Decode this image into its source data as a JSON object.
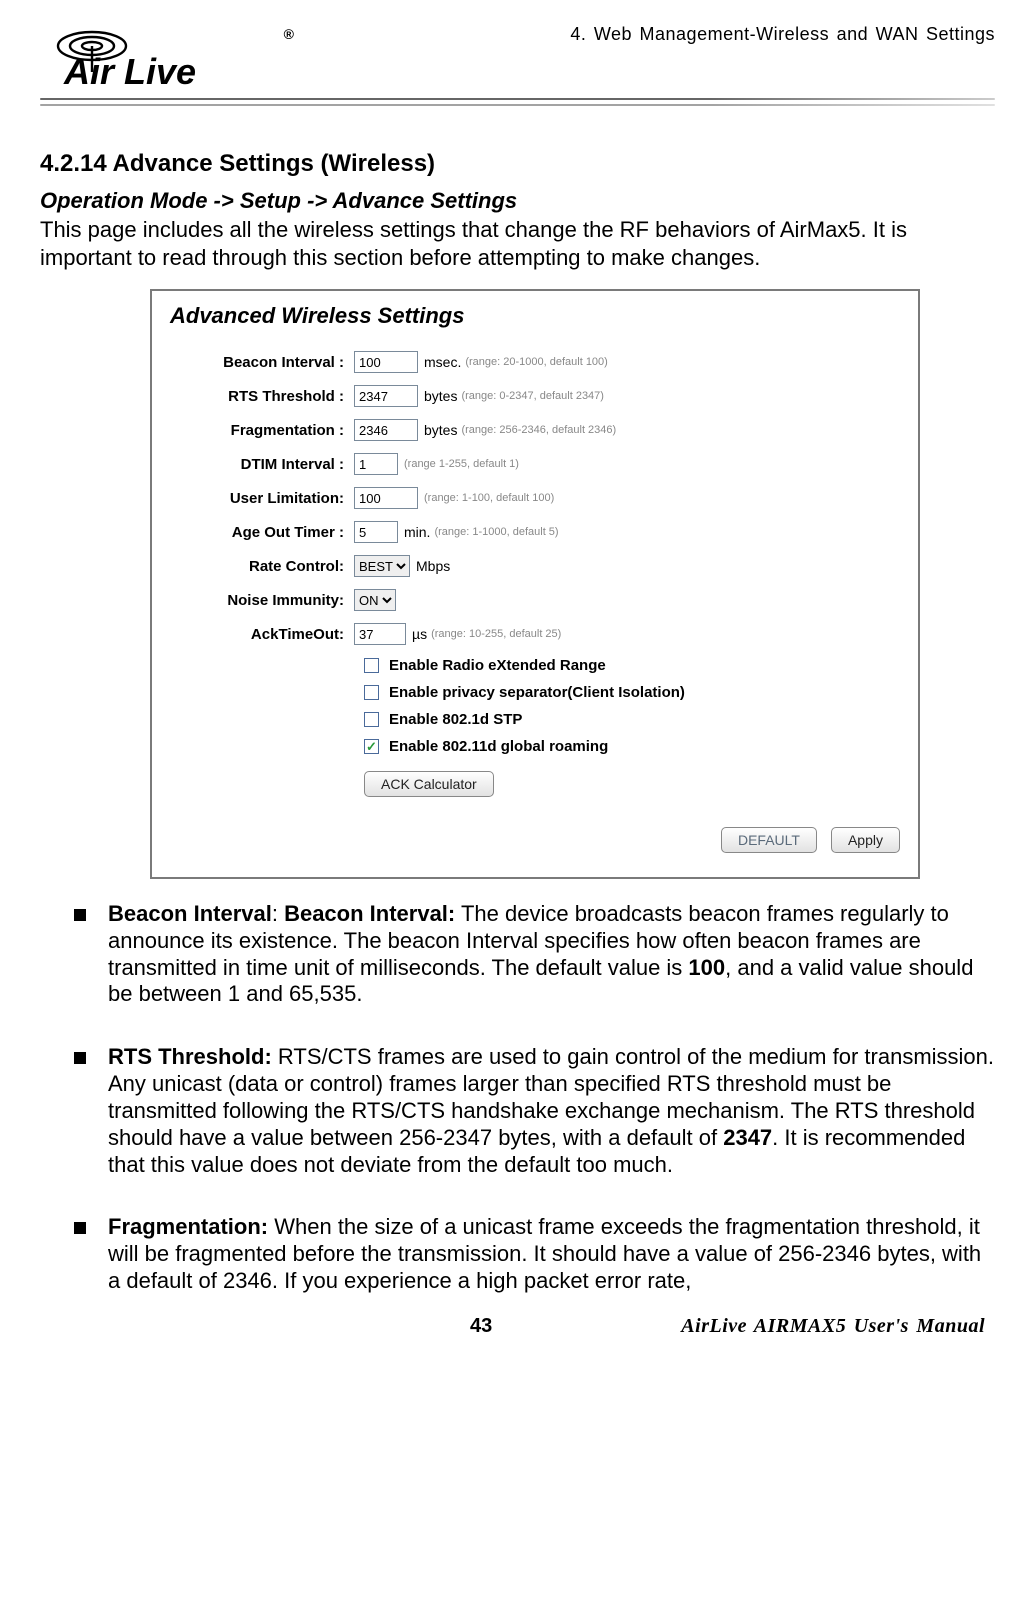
{
  "header": {
    "chapter_title": "4. Web Management-Wireless and WAN Settings",
    "logo_text": "Air Live",
    "logo_reg": "®"
  },
  "section": {
    "heading": "4.2.14 Advance Settings (Wireless)",
    "breadcrumb": "Operation Mode -> Setup -> Advance Settings",
    "intro": "This page includes all the wireless settings that change the RF behaviors of AirMax5.   It is important to read through this section before attempting to make changes."
  },
  "panel": {
    "title": "Advanced Wireless Settings",
    "fields": {
      "beacon_interval": {
        "label": "Beacon Interval :",
        "value": "100",
        "unit": "msec.",
        "hint": "(range: 20-1000, default 100)"
      },
      "rts_threshold": {
        "label": "RTS Threshold :",
        "value": "2347",
        "unit": "bytes",
        "hint": "(range: 0-2347, default 2347)"
      },
      "fragmentation": {
        "label": "Fragmentation :",
        "value": "2346",
        "unit": "bytes",
        "hint": "(range: 256-2346, default 2346)"
      },
      "dtim_interval": {
        "label": "DTIM Interval :",
        "value": "1",
        "unit": "",
        "hint": "(range 1-255, default 1)"
      },
      "user_limitation": {
        "label": "User Limitation:",
        "value": "100",
        "unit": "",
        "hint": "(range: 1-100, default 100)"
      },
      "age_out_timer": {
        "label": "Age Out Timer :",
        "value": "5",
        "unit": "min.",
        "hint": "(range: 1-1000, default 5)"
      },
      "rate_control": {
        "label": "Rate Control:",
        "value": "BEST",
        "unit": "Mbps",
        "hint": ""
      },
      "noise_immunity": {
        "label": "Noise Immunity:",
        "value": "ON",
        "unit": "",
        "hint": ""
      },
      "ack_timeout": {
        "label": "AckTimeOut:",
        "value": "37",
        "unit": "µs",
        "hint": "(range: 10-255, default 25)"
      }
    },
    "checks": {
      "ext_range": {
        "label": "Enable Radio eXtended Range",
        "checked": false
      },
      "privacy_sep": {
        "label": "Enable privacy separator(Client Isolation)",
        "checked": false
      },
      "stp": {
        "label": "Enable 802.1d STP",
        "checked": false
      },
      "roaming": {
        "label": "Enable 802.11d global roaming",
        "checked": true
      }
    },
    "buttons": {
      "ack_calc": "ACK Calculator",
      "default": "DEFAULT",
      "apply": "Apply"
    }
  },
  "bullets": {
    "b1_label": "Beacon Interval",
    "b1_colon": ": ",
    "b1_label2": "Beacon Interval:",
    "b1_text_a": " The device broadcasts beacon frames regularly to announce its existence. The beacon Interval specifies how often beacon frames are transmitted in time unit of milliseconds. The default value is ",
    "b1_bold": "100",
    "b1_text_b": ", and a valid value should be between 1 and 65,535.",
    "b2_label": "RTS Threshold:",
    "b2_text_a": " RTS/CTS frames are used to gain control of the medium for transmission. Any unicast (data or control) frames larger than specified RTS threshold must be transmitted following the RTS/CTS handshake exchange mechanism. The RTS threshold should have a value between 256-2347 bytes, with a default of ",
    "b2_bold": "2347",
    "b2_text_b": ". It is recommended that this value does not deviate from the default too much.",
    "b3_label": "Fragmentation:",
    "b3_text": " When the size of a unicast frame exceeds the fragmentation threshold, it will be fragmented before the transmission. It should have a value of 256-2346 bytes, with a default of 2346.   If you experience a high packet error rate,"
  },
  "footer": {
    "page_number": "43",
    "manual_title": "AirLive AIRMAX5 User's Manual"
  }
}
